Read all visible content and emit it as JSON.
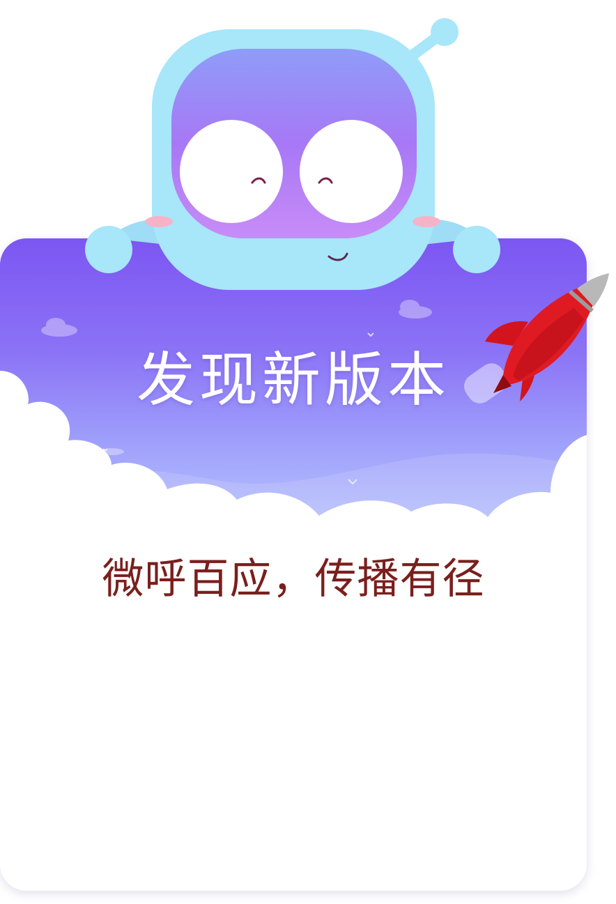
{
  "dialog": {
    "title": "发现新版本",
    "subtitle": "微呼百应，传播有径"
  },
  "icons": {
    "mascot": "robot-mascot-icon",
    "rocket": "rocket-icon"
  },
  "colors": {
    "header_top": "#7c56f2",
    "header_bottom": "#b9c4fd",
    "mascot_body": "#a8e6fa",
    "mascot_face": "#a778f6",
    "rocket_red": "#d3141c",
    "subtitle": "#7a1f1d",
    "title": "#ffffff"
  }
}
